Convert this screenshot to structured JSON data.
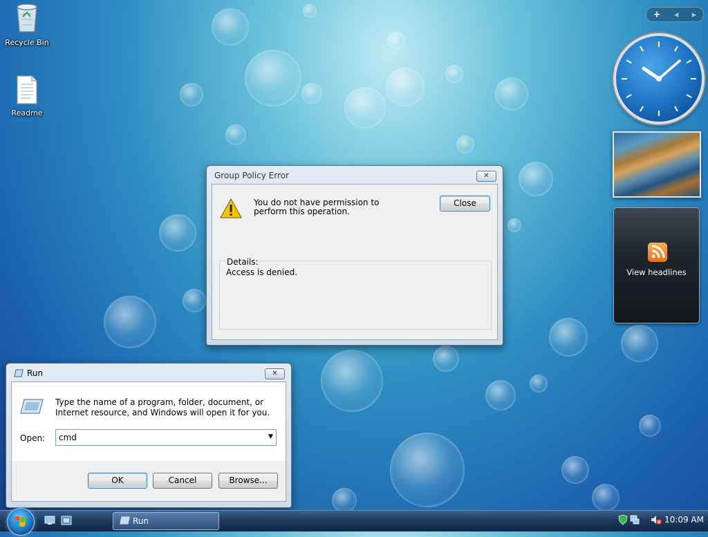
{
  "desktop": {
    "icons": [
      {
        "label": "Recycle Bin",
        "icon": "recycle-bin-icon"
      },
      {
        "label": "Readme",
        "icon": "text-document-icon"
      }
    ]
  },
  "sidebar": {
    "add_glyph": "+",
    "prev_glyph": "◂",
    "next_glyph": "▸",
    "feed_headline": "View headlines"
  },
  "error_dialog": {
    "title": "Group Policy Error",
    "message": "You do not have permission to perform this operation.",
    "close_label": "Close",
    "details_label": "Details:",
    "details_text": "Access is denied.",
    "close_glyph": "✕"
  },
  "run_dialog": {
    "title": "Run",
    "description": "Type the name of a program, folder, document, or Internet resource, and Windows will open it for you.",
    "open_label": "Open:",
    "open_value": "cmd",
    "ok_label": "OK",
    "cancel_label": "Cancel",
    "browse_label": "Browse...",
    "close_glyph": "✕"
  },
  "taskbar": {
    "task_label": "Run",
    "clock": "10:09 AM"
  },
  "colors": {
    "taskbar": "#1e3a61",
    "dialog_bg": "#f0f0f0",
    "warning": "#f5c400"
  }
}
